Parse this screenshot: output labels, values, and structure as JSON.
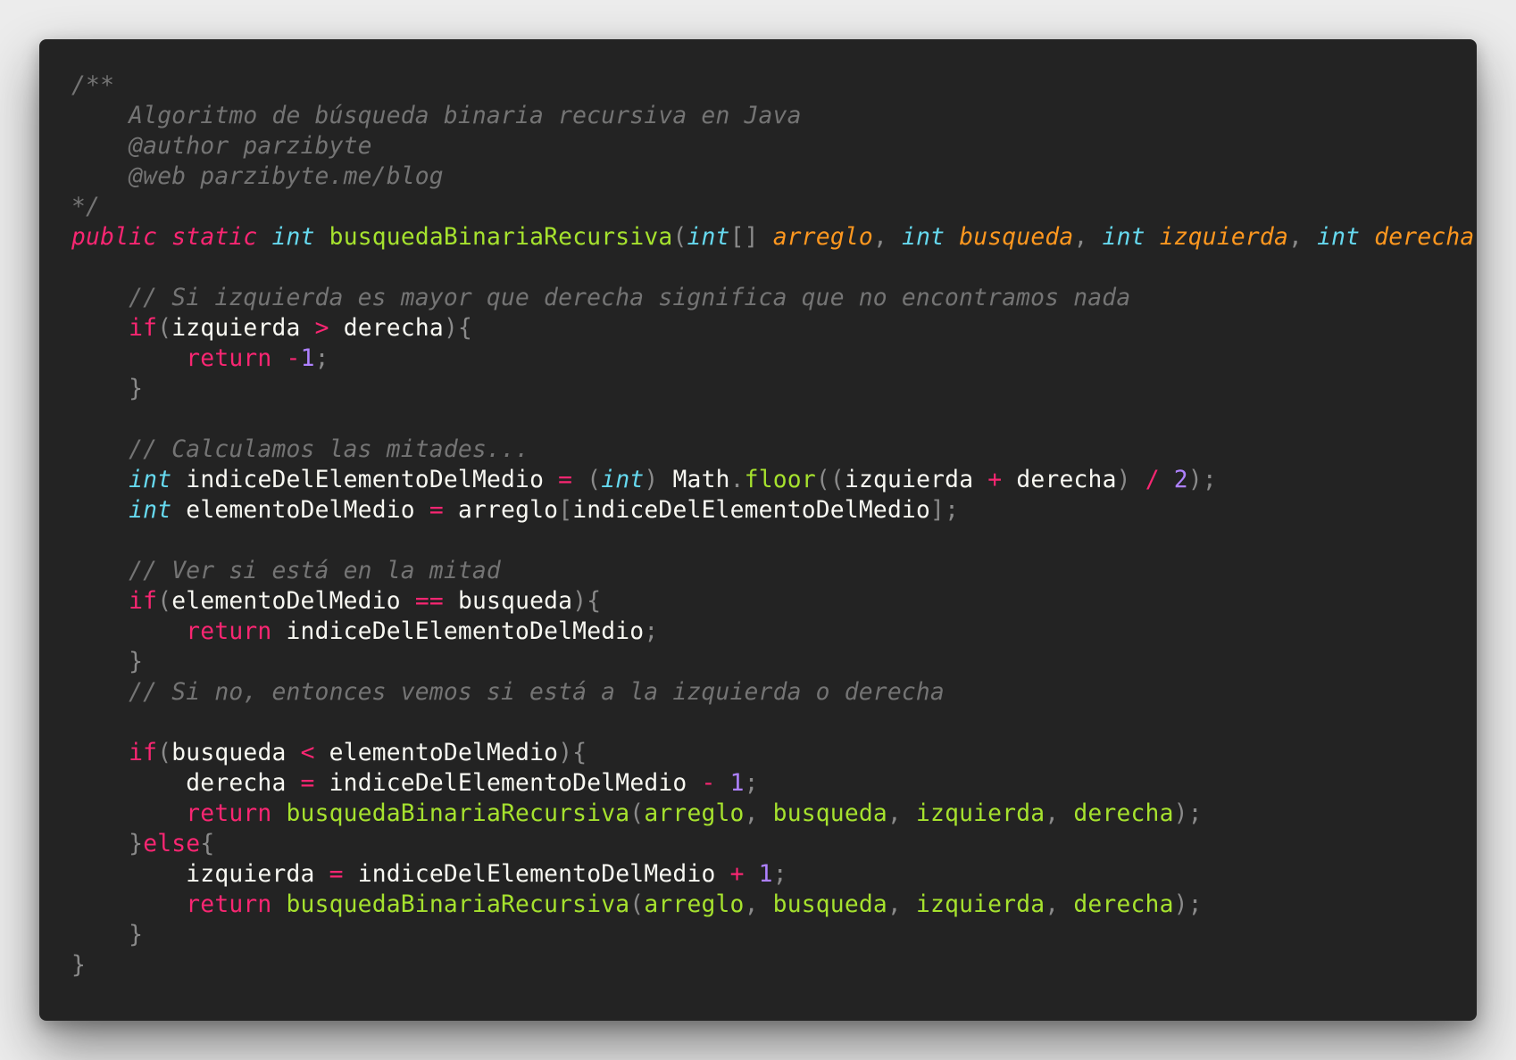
{
  "code_window": {
    "language": "Java",
    "colors": {
      "background": "#232323",
      "comment": "#747474",
      "keyword": "#f92672",
      "type": "#66d9ef",
      "function": "#a6e22e",
      "parameter": "#fd971f",
      "number": "#ae81ff",
      "text": "#f8f8f2"
    },
    "lines": [
      [
        {
          "t": "/**",
          "c": "cm"
        }
      ],
      [
        {
          "t": "    Algoritmo de búsqueda binaria recursiva en Java",
          "c": "cm"
        }
      ],
      [
        {
          "t": "    @author parzibyte",
          "c": "cm"
        }
      ],
      [
        {
          "t": "    @web parzibyte.me/blog",
          "c": "cm"
        }
      ],
      [
        {
          "t": "*/",
          "c": "cm"
        }
      ],
      [
        {
          "t": "public",
          "c": "kw"
        },
        {
          "t": " ",
          "c": "id"
        },
        {
          "t": "static",
          "c": "kw"
        },
        {
          "t": " ",
          "c": "id"
        },
        {
          "t": "int",
          "c": "ty"
        },
        {
          "t": " ",
          "c": "id"
        },
        {
          "t": "busquedaBinariaRecursiva",
          "c": "fn"
        },
        {
          "t": "(",
          "c": "pu"
        },
        {
          "t": "int",
          "c": "ty"
        },
        {
          "t": "[]",
          "c": "pu"
        },
        {
          "t": " ",
          "c": "id"
        },
        {
          "t": "arreglo",
          "c": "pa"
        },
        {
          "t": ", ",
          "c": "pu"
        },
        {
          "t": "int",
          "c": "ty"
        },
        {
          "t": " ",
          "c": "id"
        },
        {
          "t": "busqueda",
          "c": "pa"
        },
        {
          "t": ", ",
          "c": "pu"
        },
        {
          "t": "int",
          "c": "ty"
        },
        {
          "t": " ",
          "c": "id"
        },
        {
          "t": "izquierda",
          "c": "pa"
        },
        {
          "t": ", ",
          "c": "pu"
        },
        {
          "t": "int",
          "c": "ty"
        },
        {
          "t": " ",
          "c": "id"
        },
        {
          "t": "derecha",
          "c": "pa"
        },
        {
          "t": "){",
          "c": "pu"
        }
      ],
      [],
      [
        {
          "t": "    // Si izquierda es mayor que derecha significa que no encontramos nada",
          "c": "cm"
        }
      ],
      [
        {
          "t": "    ",
          "c": "id"
        },
        {
          "t": "if",
          "c": "kwn"
        },
        {
          "t": "(",
          "c": "pu"
        },
        {
          "t": "izquierda",
          "c": "id"
        },
        {
          "t": " ",
          "c": "id"
        },
        {
          "t": ">",
          "c": "op"
        },
        {
          "t": " ",
          "c": "id"
        },
        {
          "t": "derecha",
          "c": "id"
        },
        {
          "t": "){",
          "c": "pu"
        }
      ],
      [
        {
          "t": "        ",
          "c": "id"
        },
        {
          "t": "return",
          "c": "kwn"
        },
        {
          "t": " ",
          "c": "id"
        },
        {
          "t": "-",
          "c": "op"
        },
        {
          "t": "1",
          "c": "num"
        },
        {
          "t": ";",
          "c": "pu"
        }
      ],
      [
        {
          "t": "    ",
          "c": "id"
        },
        {
          "t": "}",
          "c": "pu"
        }
      ],
      [],
      [
        {
          "t": "    // Calculamos las mitades...",
          "c": "cm"
        }
      ],
      [
        {
          "t": "    ",
          "c": "id"
        },
        {
          "t": "int",
          "c": "ty"
        },
        {
          "t": " ",
          "c": "id"
        },
        {
          "t": "indiceDelElementoDelMedio",
          "c": "id"
        },
        {
          "t": " ",
          "c": "id"
        },
        {
          "t": "=",
          "c": "op"
        },
        {
          "t": " ",
          "c": "id"
        },
        {
          "t": "(",
          "c": "pu"
        },
        {
          "t": "int",
          "c": "ty"
        },
        {
          "t": ")",
          "c": "pu"
        },
        {
          "t": " ",
          "c": "id"
        },
        {
          "t": "Math",
          "c": "id"
        },
        {
          "t": ".",
          "c": "pu"
        },
        {
          "t": "floor",
          "c": "fnc"
        },
        {
          "t": "((",
          "c": "pu"
        },
        {
          "t": "izquierda",
          "c": "id"
        },
        {
          "t": " ",
          "c": "id"
        },
        {
          "t": "+",
          "c": "op"
        },
        {
          "t": " ",
          "c": "id"
        },
        {
          "t": "derecha",
          "c": "id"
        },
        {
          "t": ")",
          "c": "pu"
        },
        {
          "t": " ",
          "c": "id"
        },
        {
          "t": "/",
          "c": "op"
        },
        {
          "t": " ",
          "c": "id"
        },
        {
          "t": "2",
          "c": "num"
        },
        {
          "t": ");",
          "c": "pu"
        }
      ],
      [
        {
          "t": "    ",
          "c": "id"
        },
        {
          "t": "int",
          "c": "ty"
        },
        {
          "t": " ",
          "c": "id"
        },
        {
          "t": "elementoDelMedio",
          "c": "id"
        },
        {
          "t": " ",
          "c": "id"
        },
        {
          "t": "=",
          "c": "op"
        },
        {
          "t": " ",
          "c": "id"
        },
        {
          "t": "arreglo",
          "c": "id"
        },
        {
          "t": "[",
          "c": "pu"
        },
        {
          "t": "indiceDelElementoDelMedio",
          "c": "id"
        },
        {
          "t": "];",
          "c": "pu"
        }
      ],
      [],
      [
        {
          "t": "    // Ver si está en la mitad",
          "c": "cm"
        }
      ],
      [
        {
          "t": "    ",
          "c": "id"
        },
        {
          "t": "if",
          "c": "kwn"
        },
        {
          "t": "(",
          "c": "pu"
        },
        {
          "t": "elementoDelMedio",
          "c": "id"
        },
        {
          "t": " ",
          "c": "id"
        },
        {
          "t": "==",
          "c": "op"
        },
        {
          "t": " ",
          "c": "id"
        },
        {
          "t": "busqueda",
          "c": "id"
        },
        {
          "t": "){",
          "c": "pu"
        }
      ],
      [
        {
          "t": "        ",
          "c": "id"
        },
        {
          "t": "return",
          "c": "kwn"
        },
        {
          "t": " ",
          "c": "id"
        },
        {
          "t": "indiceDelElementoDelMedio",
          "c": "id"
        },
        {
          "t": ";",
          "c": "pu"
        }
      ],
      [
        {
          "t": "    ",
          "c": "id"
        },
        {
          "t": "}",
          "c": "pu"
        }
      ],
      [
        {
          "t": "    // Si no, entonces vemos si está a la izquierda o derecha",
          "c": "cm"
        }
      ],
      [],
      [
        {
          "t": "    ",
          "c": "id"
        },
        {
          "t": "if",
          "c": "kwn"
        },
        {
          "t": "(",
          "c": "pu"
        },
        {
          "t": "busqueda",
          "c": "id"
        },
        {
          "t": " ",
          "c": "id"
        },
        {
          "t": "<",
          "c": "op"
        },
        {
          "t": " ",
          "c": "id"
        },
        {
          "t": "elementoDelMedio",
          "c": "id"
        },
        {
          "t": "){",
          "c": "pu"
        }
      ],
      [
        {
          "t": "        ",
          "c": "id"
        },
        {
          "t": "derecha",
          "c": "id"
        },
        {
          "t": " ",
          "c": "id"
        },
        {
          "t": "=",
          "c": "op"
        },
        {
          "t": " ",
          "c": "id"
        },
        {
          "t": "indiceDelElementoDelMedio",
          "c": "id"
        },
        {
          "t": " ",
          "c": "id"
        },
        {
          "t": "-",
          "c": "op"
        },
        {
          "t": " ",
          "c": "id"
        },
        {
          "t": "1",
          "c": "num"
        },
        {
          "t": ";",
          "c": "pu"
        }
      ],
      [
        {
          "t": "        ",
          "c": "id"
        },
        {
          "t": "return",
          "c": "kwn"
        },
        {
          "t": " ",
          "c": "id"
        },
        {
          "t": "busquedaBinariaRecursiva",
          "c": "fnc"
        },
        {
          "t": "(",
          "c": "pu"
        },
        {
          "t": "arreglo",
          "c": "arg"
        },
        {
          "t": ", ",
          "c": "pu"
        },
        {
          "t": "busqueda",
          "c": "arg"
        },
        {
          "t": ", ",
          "c": "pu"
        },
        {
          "t": "izquierda",
          "c": "arg"
        },
        {
          "t": ", ",
          "c": "pu"
        },
        {
          "t": "derecha",
          "c": "arg"
        },
        {
          "t": ");",
          "c": "pu"
        }
      ],
      [
        {
          "t": "    ",
          "c": "id"
        },
        {
          "t": "}",
          "c": "pu"
        },
        {
          "t": "else",
          "c": "kwn"
        },
        {
          "t": "{",
          "c": "pu"
        }
      ],
      [
        {
          "t": "        ",
          "c": "id"
        },
        {
          "t": "izquierda",
          "c": "id"
        },
        {
          "t": " ",
          "c": "id"
        },
        {
          "t": "=",
          "c": "op"
        },
        {
          "t": " ",
          "c": "id"
        },
        {
          "t": "indiceDelElementoDelMedio",
          "c": "id"
        },
        {
          "t": " ",
          "c": "id"
        },
        {
          "t": "+",
          "c": "op"
        },
        {
          "t": " ",
          "c": "id"
        },
        {
          "t": "1",
          "c": "num"
        },
        {
          "t": ";",
          "c": "pu"
        }
      ],
      [
        {
          "t": "        ",
          "c": "id"
        },
        {
          "t": "return",
          "c": "kwn"
        },
        {
          "t": " ",
          "c": "id"
        },
        {
          "t": "busquedaBinariaRecursiva",
          "c": "fnc"
        },
        {
          "t": "(",
          "c": "pu"
        },
        {
          "t": "arreglo",
          "c": "arg"
        },
        {
          "t": ", ",
          "c": "pu"
        },
        {
          "t": "busqueda",
          "c": "arg"
        },
        {
          "t": ", ",
          "c": "pu"
        },
        {
          "t": "izquierda",
          "c": "arg"
        },
        {
          "t": ", ",
          "c": "pu"
        },
        {
          "t": "derecha",
          "c": "arg"
        },
        {
          "t": ");",
          "c": "pu"
        }
      ],
      [
        {
          "t": "    ",
          "c": "id"
        },
        {
          "t": "}",
          "c": "pu"
        }
      ],
      [
        {
          "t": "}",
          "c": "pu"
        }
      ]
    ]
  }
}
